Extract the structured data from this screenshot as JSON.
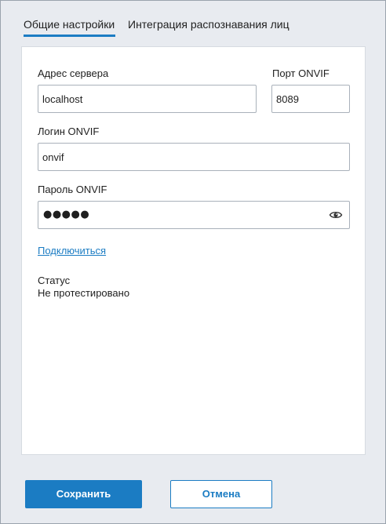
{
  "tabs": {
    "general": "Общие настройки",
    "face_recognition": "Интеграция распознавания лиц",
    "active": "general"
  },
  "form": {
    "server_address": {
      "label": "Адрес сервера",
      "value": "localhost"
    },
    "onvif_port": {
      "label": "Порт ONVIF",
      "value": "8089"
    },
    "onvif_login": {
      "label": "Логин ONVIF",
      "value": "onvif"
    },
    "onvif_password": {
      "label": "Пароль ONVIF",
      "masked_value": "●●●●●"
    },
    "connect_link": "Подключиться",
    "status_label": "Статус",
    "status_value": "Не протестировано"
  },
  "footer": {
    "save_label": "Сохранить",
    "cancel_label": "Отмена"
  },
  "colors": {
    "accent": "#1b7cc3",
    "window_background": "#e8ebf0",
    "panel_background": "#ffffff",
    "field_border": "#a9b1ba"
  },
  "icons": {
    "password_visibility": "eye-icon"
  }
}
